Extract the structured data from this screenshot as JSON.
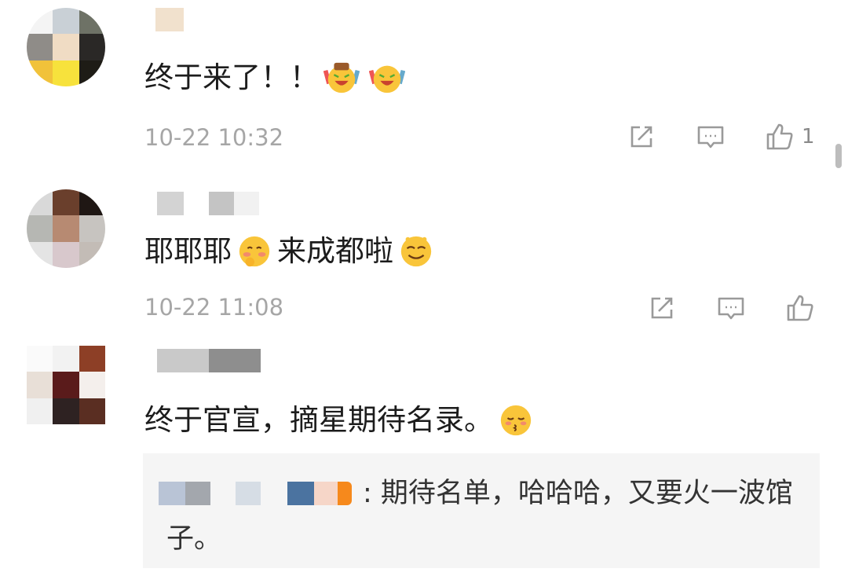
{
  "comments": [
    {
      "text": "终于来了！！",
      "emojis": [
        "cheering-emoji",
        "cheering-emoji"
      ],
      "time": "10-22 10:32",
      "like_count": "1"
    },
    {
      "text_a": "耶耶耶",
      "text_b": "来成都啦",
      "emojis": [
        "shy-emoji",
        "smile-emoji"
      ],
      "time": "10-22 11:08",
      "like_count": ""
    },
    {
      "text": "终于官宣，摘星期待名录。",
      "emojis": [
        "kiss-emoji"
      ],
      "reply": {
        "text": ": 期待名单，哈哈哈，又要火一波馆子。"
      }
    }
  ],
  "icons": {
    "share": "share-icon",
    "comment": "comment-icon",
    "like": "thumbs-up-icon"
  },
  "colors": {
    "text": "#1c1c1c",
    "time": "#a6a6a6",
    "icon": "#9a9a9a",
    "reply_bg": "#f5f5f5"
  }
}
